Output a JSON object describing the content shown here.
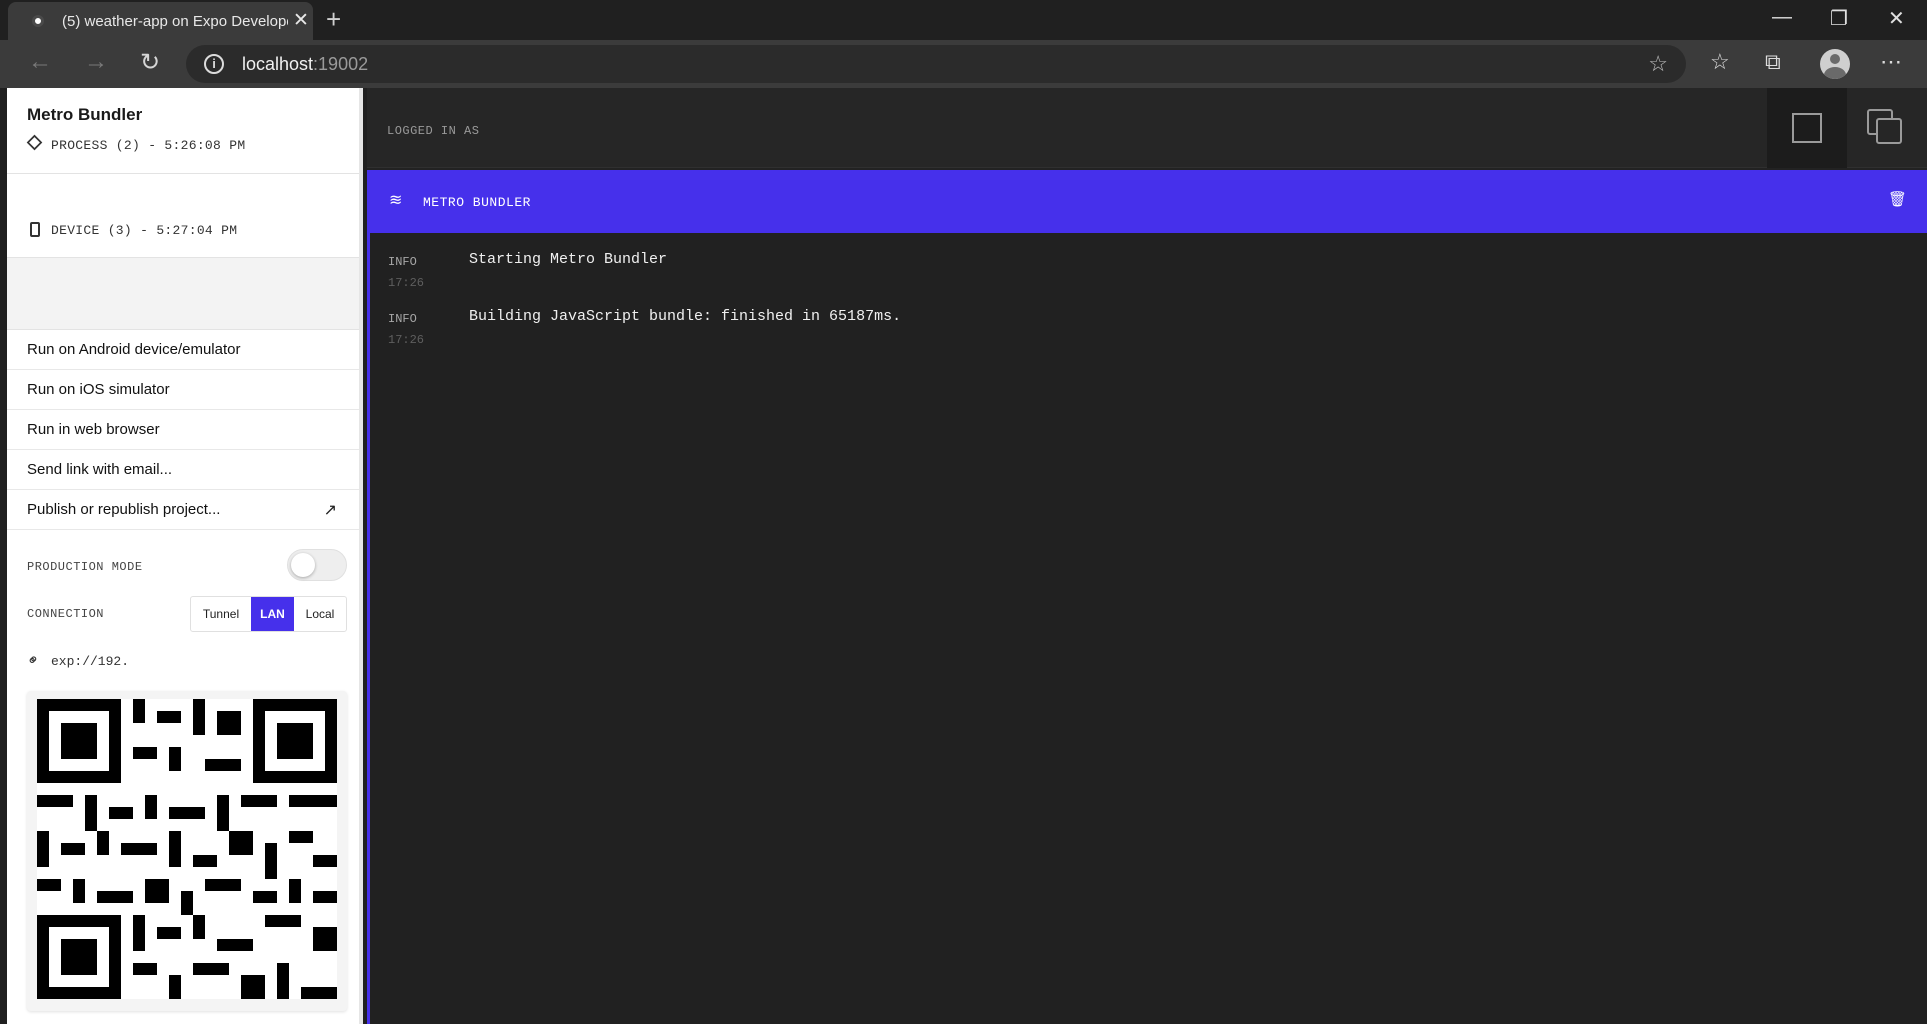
{
  "browser": {
    "tab_title": "(5) weather-app on Expo Developer Tools",
    "url_host": "localhost",
    "url_port": ":19002"
  },
  "sidebar": {
    "process_title": "Metro Bundler",
    "process_sub": "PROCESS (2) - 5:26:08 PM",
    "device_title": "",
    "device_sub": "DEVICE (3) - 5:27:04 PM",
    "menu": [
      {
        "label": "Run on Android device/emulator"
      },
      {
        "label": "Run on iOS simulator"
      },
      {
        "label": "Run in web browser"
      },
      {
        "label": "Send link with email..."
      },
      {
        "label": "Publish or republish project..."
      }
    ],
    "production_mode_label": "PRODUCTION MODE",
    "production_mode_on": false,
    "connection_label": "CONNECTION",
    "connection_options": [
      "Tunnel",
      "LAN",
      "Local"
    ],
    "connection_selected": "LAN",
    "exp_url": "exp://192."
  },
  "main": {
    "logged_in_label": "LOGGED IN AS",
    "panel_title": "METRO BUNDLER",
    "accent_color": "#4630eb",
    "logs": [
      {
        "level": "INFO",
        "time": "17:26",
        "message": "Starting Metro Bundler"
      },
      {
        "level": "INFO",
        "time": "17:26",
        "message": "Building JavaScript bundle: finished in 65187ms."
      }
    ]
  }
}
